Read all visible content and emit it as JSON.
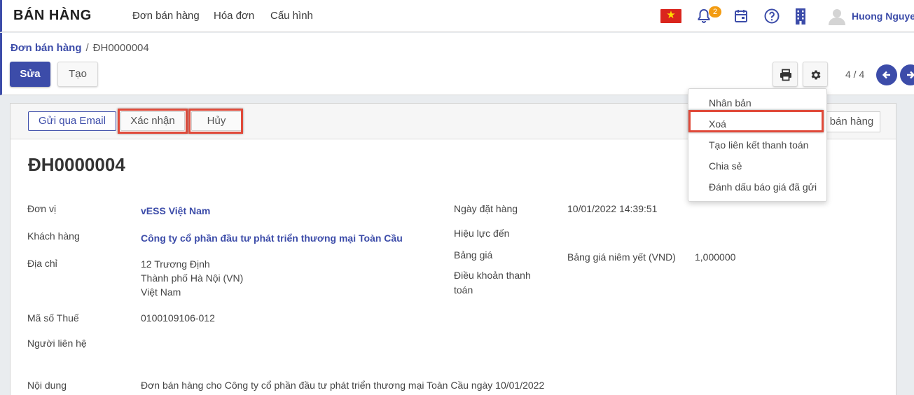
{
  "topbar": {
    "app_title": "BÁN HÀNG",
    "nav": [
      "Đơn bán hàng",
      "Hóa đơn",
      "Cấu hình"
    ],
    "notification_count": "2",
    "user_name": "Huong Nguyen"
  },
  "control": {
    "breadcrumb_parent": "Đơn bán hàng",
    "breadcrumb_separator": "/",
    "breadcrumb_current": "ĐH0000004",
    "edit_label": "Sửa",
    "create_label": "Tạo",
    "pager": "4 / 4"
  },
  "statusbar": {
    "email_label": "Gửi qua Email",
    "confirm_label": "Xác nhận",
    "cancel_label": "Hủy",
    "state_label": "bán hàng"
  },
  "dropdown": {
    "items": [
      "Nhân bản",
      "Xoá",
      "Tạo liên kết thanh toán",
      "Chia sẻ",
      "Đánh dấu báo giá đã gửi"
    ]
  },
  "form": {
    "title": "ĐH0000004",
    "unit_label": "Đơn vị",
    "unit_value": "vESS Việt Nam",
    "customer_label": "Khách hàng",
    "customer_value": "Công ty cổ phần đầu tư phát triển thương mại Toàn Cầu",
    "address_label": "Địa chỉ",
    "address_lines": [
      "12 Trương Định",
      "Thành phố Hà Nội (VN)",
      "Việt Nam"
    ],
    "tax_label": "Mã số Thuế",
    "tax_value": "0100109106-012",
    "contact_label": "Người liên hệ",
    "content_label": "Nội dung",
    "content_value": "Đơn bán hàng cho Công ty cổ phần đầu tư phát triển thương mại Toàn Cầu ngày 10/01/2022",
    "order_date_label": "Ngày đặt hàng",
    "order_date_value": "10/01/2022 14:39:51",
    "validity_label": "Hiệu lực đến",
    "pricelist_label": "Bảng giá",
    "pricelist_value": "Bảng giá niêm yết (VND)",
    "pricelist_rate": "1,000000",
    "payment_terms_label_1": "Điều khoản thanh",
    "payment_terms_label_2": "toán"
  },
  "colors": {
    "accent": "#3c4ca9",
    "highlight": "#e04a3a",
    "badge": "#f39c12"
  }
}
